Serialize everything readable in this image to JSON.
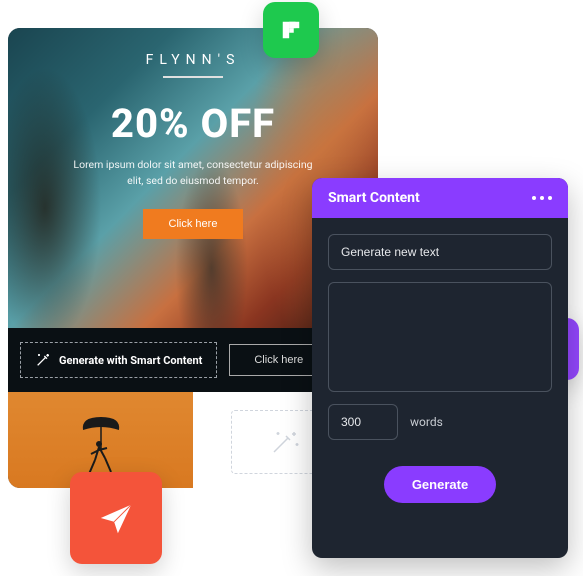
{
  "ad": {
    "brand": "FLYNN'S",
    "headline": "20% OFF",
    "subtext": "Lorem ipsum dolor sit amet, consectetur adipiscing elit, sed do eiusmod tempor.",
    "cta": "Click here",
    "smart_button": "Generate with Smart Content",
    "secondary_cta": "Click here"
  },
  "panel": {
    "title": "Smart Content",
    "prompt_value": "Generate new text",
    "words_value": "300",
    "words_label": "words",
    "generate_label": "Generate"
  },
  "colors": {
    "accent_purple": "#8a3cff",
    "accent_orange": "#f07b1f",
    "panel_bg": "#1e2530",
    "icon_green": "#1ec94e",
    "icon_red": "#f4543a"
  }
}
